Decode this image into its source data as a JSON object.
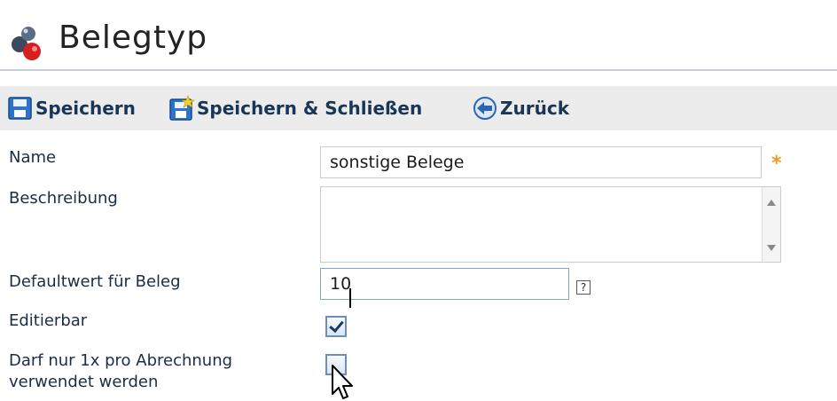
{
  "header": {
    "title": "Belegtyp",
    "icon": "belegtyp-app-icon"
  },
  "toolbar": {
    "save_label": "Speichern",
    "save_close_label": "Speichern & Schließen",
    "back_label": "Zurück"
  },
  "form": {
    "name_label": "Name",
    "name_value": "sonstige Belege",
    "required_marker": "*",
    "description_label": "Beschreibung",
    "description_value": "",
    "default_label": "Defaultwert für Beleg",
    "default_value": "10",
    "help_marker": "?",
    "editable_label": "Editierbar",
    "editable_checked": true,
    "once_label_line1": "Darf nur 1x pro Abrechnung",
    "once_label_line2": "verwendet werden",
    "once_checked": false
  },
  "colors": {
    "toolbar_bg": "#ececec",
    "label_text": "#1a2d44",
    "required": "#f09a26"
  }
}
